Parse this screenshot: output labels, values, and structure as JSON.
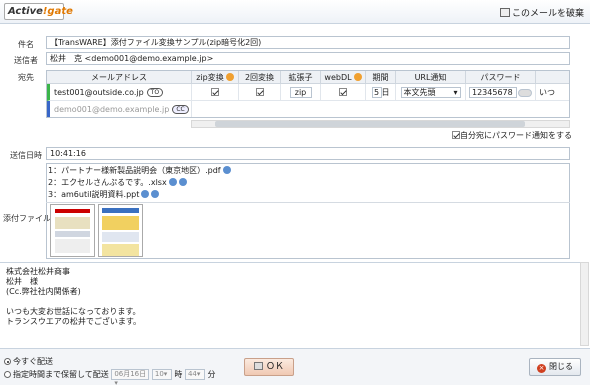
{
  "app": {
    "logo_text": "Active",
    "logo_accent": "!gate",
    "discard_label": "このメールを破棄"
  },
  "fields": {
    "subject_label": "件名",
    "subject_value": "【TransWARE】添付ファイル変換サンプル(zip暗号化2回)",
    "sender_label": "送信者",
    "sender_value": "松井　克 <demo001@demo.example.jp>",
    "recipient_label": "宛先",
    "sent_label": "送信日時",
    "sent_value": "10:41:16",
    "attach_label": "添付ファイル"
  },
  "recipients": {
    "headers": [
      "メールアドレス",
      "zip変換",
      "2回変換",
      "拡張子",
      "webDL",
      "期間",
      "URL通知",
      "パスワード"
    ],
    "rows": [
      {
        "email": "test001@outside.co.jp",
        "tag": "TO",
        "zip": true,
        "twice": true,
        "ext": "zip",
        "webdl": true,
        "days": "5",
        "days_unit": "日",
        "url": "本文先頭",
        "password": "12345678",
        "extra": "いつ"
      },
      {
        "email": "demo001@demo.example.jp",
        "tag": "CC"
      }
    ],
    "self_notify_label": "自分宛にパスワード通知をする"
  },
  "attachments": [
    {
      "text": "1：パートナー様新製品説明会（東京地区）.pdf"
    },
    {
      "text": "2：エクセルさんぷるです。.xlsx"
    },
    {
      "text": "3：am6util説明資料.ppt"
    }
  ],
  "body_lines": [
    "株式会社松井商事",
    "松井　様",
    "(Cc.弊社社内関係者)",
    "",
    "いつも大変お世話になっております。",
    "トランスウエアの松井でございます。"
  ],
  "footer": {
    "send_now": "今すぐ配送",
    "send_later": "指定時間まで保留して配送",
    "date_value": "06月16日",
    "hour_value": "10",
    "hour_unit": "時",
    "min_value": "44",
    "min_unit": "分",
    "ok_label": "ＯＫ",
    "close_label": "閉じる"
  }
}
